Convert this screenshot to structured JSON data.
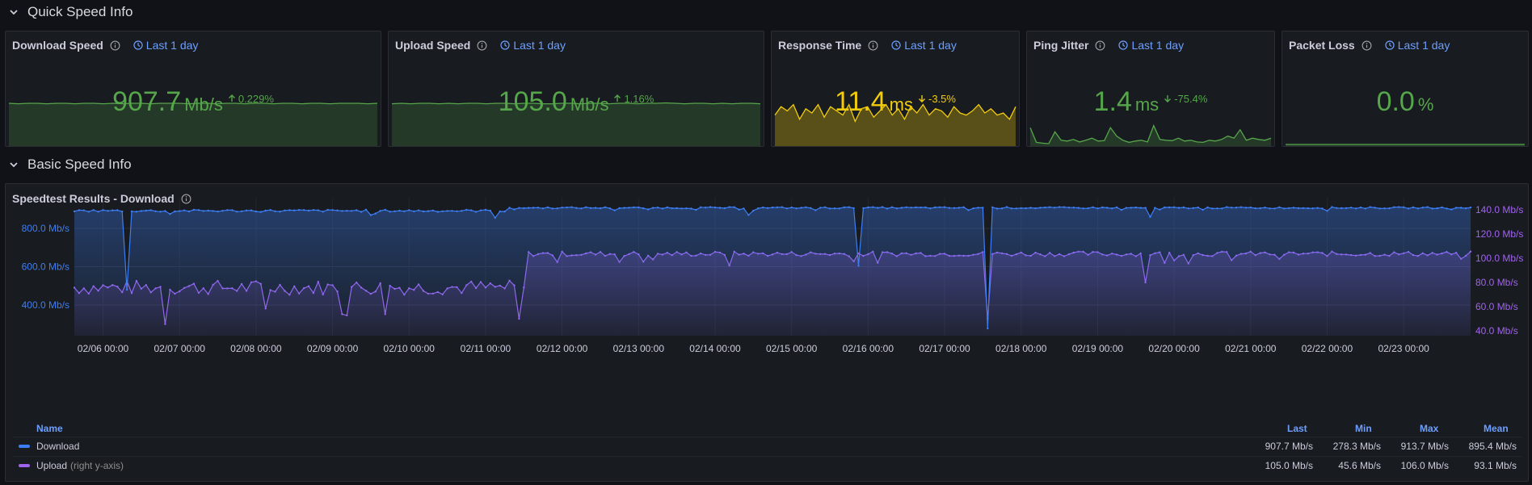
{
  "rows": [
    {
      "title": "Quick Speed Info"
    },
    {
      "title": "Basic Speed Info"
    }
  ],
  "stats": [
    {
      "title": "Download Speed",
      "time": "Last 1 day",
      "value": "907.7",
      "unit": "Mb/s",
      "delta": "0.229%",
      "delta_dir": "up",
      "color": "#56a64b",
      "spark": [
        98,
        97,
        98,
        98,
        97,
        98,
        98,
        97,
        98,
        98,
        97,
        98,
        97,
        98,
        98,
        97,
        98,
        98,
        98,
        97,
        98,
        98,
        97,
        98,
        98,
        97,
        98,
        98,
        97,
        98,
        98,
        97,
        98,
        98,
        97,
        98,
        98,
        98,
        97,
        98
      ]
    },
    {
      "title": "Upload Speed",
      "time": "Last 1 day",
      "value": "105.0",
      "unit": "Mb/s",
      "delta": "1.16%",
      "delta_dir": "up",
      "color": "#56a64b",
      "spark": [
        97,
        98,
        97,
        98,
        98,
        97,
        98,
        97,
        98,
        98,
        97,
        98,
        98,
        97,
        98,
        98,
        97,
        97,
        98,
        98,
        97,
        98,
        98,
        97,
        98,
        98,
        97,
        98,
        98,
        99,
        98,
        97,
        98,
        98,
        97,
        98,
        97,
        98,
        98,
        97
      ]
    },
    {
      "title": "Response Time",
      "time": "Last 1 day",
      "value": "11.4",
      "unit": "ms",
      "delta": "-3.5%",
      "delta_dir": "down",
      "color": "#f2cc0c",
      "spark": [
        70,
        90,
        80,
        95,
        60,
        85,
        75,
        95,
        65,
        90,
        80,
        70,
        95,
        55,
        85,
        90,
        65,
        80,
        95,
        70,
        85,
        60,
        90,
        75,
        95,
        70,
        85,
        80,
        65,
        90,
        75,
        70,
        80,
        95,
        75,
        85,
        70,
        75,
        60,
        90
      ]
    },
    {
      "title": "Ping Jitter",
      "time": "Last 1 day",
      "value": "1.4",
      "unit": "ms",
      "delta": "-75.4%",
      "delta_dir": "down",
      "color": "#56a64b",
      "spark": [
        40,
        5,
        3,
        2,
        30,
        10,
        8,
        12,
        6,
        10,
        15,
        8,
        9,
        40,
        20,
        10,
        5,
        8,
        10,
        6,
        45,
        12,
        10,
        9,
        15,
        8,
        10,
        6,
        5,
        10,
        8,
        12,
        20,
        15,
        35,
        10,
        15,
        12,
        10,
        15
      ]
    },
    {
      "title": "Packet Loss",
      "time": "Last 1 day",
      "value": "0.0",
      "unit": "%",
      "delta": "",
      "delta_dir": "none",
      "color": "#56a64b",
      "spark": [
        0,
        0,
        0,
        0,
        0,
        0,
        0,
        0,
        0,
        0,
        0,
        0,
        0,
        0,
        0,
        0,
        0,
        0,
        0,
        0,
        0,
        0,
        0,
        0,
        0,
        0,
        0,
        0,
        0,
        0,
        0,
        0,
        0,
        0,
        0,
        0,
        0,
        0,
        0,
        0
      ]
    }
  ],
  "timeseries": {
    "title": "Speedtest Results - Download",
    "x_ticks": [
      "02/06 00:00",
      "02/07 00:00",
      "02/08 00:00",
      "02/09 00:00",
      "02/10 00:00",
      "02/11 00:00",
      "02/12 00:00",
      "02/13 00:00",
      "02/14 00:00",
      "02/15 00:00",
      "02/16 00:00",
      "02/17 00:00",
      "02/18 00:00",
      "02/19 00:00",
      "02/20 00:00",
      "02/21 00:00",
      "02/22 00:00",
      "02/23 00:00"
    ],
    "left_ticks": [
      {
        "v": 400,
        "label": "400.0 Mb/s"
      },
      {
        "v": 600,
        "label": "600.0 Mb/s"
      },
      {
        "v": 800,
        "label": "800.0 Mb/s"
      }
    ],
    "right_ticks": [
      {
        "v": 40,
        "label": "40.0 Mb/s"
      },
      {
        "v": 60,
        "label": "60.0 Mb/s"
      },
      {
        "v": 80,
        "label": "80.0 Mb/s"
      },
      {
        "v": 100,
        "label": "100.0 Mb/s"
      },
      {
        "v": 120,
        "label": "120.0 Mb/s"
      },
      {
        "v": 140,
        "label": "140.0 Mb/s"
      }
    ]
  },
  "legend": {
    "headers": {
      "name": "Name",
      "last": "Last",
      "min": "Min",
      "max": "Max",
      "mean": "Mean"
    },
    "rows": [
      {
        "name": "Download",
        "note": "",
        "color": "#3d7ef5",
        "last": "907.7 Mb/s",
        "min": "278.3 Mb/s",
        "max": "913.7 Mb/s",
        "mean": "895.4 Mb/s"
      },
      {
        "name": "Upload",
        "note": "(right y-axis)",
        "color": "#a063ee",
        "last": "105.0 Mb/s",
        "min": "45.6 Mb/s",
        "max": "106.0 Mb/s",
        "mean": "93.1 Mb/s"
      }
    ]
  },
  "chart_data": {
    "type": "line",
    "x_range": [
      "02/05 15:00",
      "02/23 21:00"
    ],
    "series": [
      {
        "name": "Download",
        "axis": "left",
        "color": "#3d7ef5",
        "segments": [
          {
            "from": "02/05 15:00",
            "to": "02/11 06:00",
            "level": 893,
            "jitter": 6
          },
          {
            "from": "02/11 06:00",
            "to": "02/23 21:00",
            "level": 908,
            "jitter": 4
          }
        ],
        "dips": [
          {
            "at": "02/06 08:00",
            "value": 480
          },
          {
            "at": "02/11 03:00",
            "value": 855
          },
          {
            "at": "02/15 21:00",
            "value": 605
          },
          {
            "at": "02/17 13:00",
            "value": 278.3
          },
          {
            "at": "02/19 17:00",
            "value": 860
          },
          {
            "at": "02/14 10:00",
            "value": 870
          }
        ],
        "stats": {
          "last": 907.7,
          "min": 278.3,
          "max": 913.7,
          "mean": 895.4
        }
      },
      {
        "name": "Upload",
        "axis": "right",
        "color": "#a063ee",
        "segments": [
          {
            "from": "02/05 15:00",
            "to": "02/11 12:00",
            "level": 77,
            "jitter": 6
          },
          {
            "from": "02/11 12:00",
            "to": "02/23 21:00",
            "level": 104,
            "jitter": 2
          }
        ],
        "dips": [
          {
            "at": "02/06 20:00",
            "value": 45.6
          },
          {
            "at": "02/11 10:00",
            "value": 50
          },
          {
            "at": "02/14 04:00",
            "value": 94
          },
          {
            "at": "02/17 13:00",
            "value": 50
          },
          {
            "at": "02/19 15:00",
            "value": 80
          }
        ],
        "stats": {
          "last": 105.0,
          "min": 45.6,
          "max": 106.0,
          "mean": 93.1
        }
      }
    ],
    "y_left": {
      "range": [
        240,
        960
      ],
      "unit": "Mb/s"
    },
    "y_right": {
      "range": [
        36,
        150
      ],
      "unit": "Mb/s"
    },
    "grid": true,
    "legend_placement": "bottom"
  }
}
